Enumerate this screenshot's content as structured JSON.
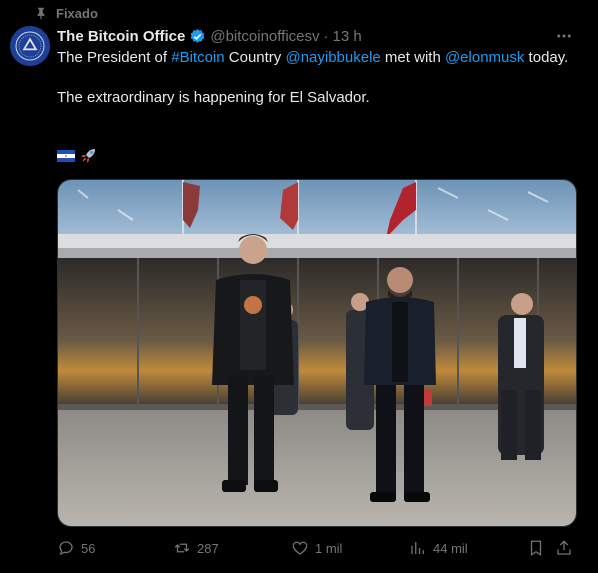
{
  "pinned_label": "Fixado",
  "author": {
    "name": "The Bitcoin Office",
    "handle": "@bitcoinofficesv",
    "separator": "·",
    "time": "13 h"
  },
  "tweet": {
    "part1": "The President of ",
    "hashtag": "#Bitcoin",
    "part2": " Country ",
    "mention1": "@nayibbukele",
    "part3": " met with ",
    "mention2": "@elonmusk",
    "part4": " today.",
    "line2": "The extraordinary is happening for El Salvador."
  },
  "emojis": [
    "el-salvador-flag",
    "rocket"
  ],
  "stats": {
    "replies": "56",
    "reposts": "287",
    "likes": "1 mil",
    "views": "44 mil"
  },
  "icons": {
    "pin": "pin-icon",
    "verified": "verified-badge-icon",
    "more": "more-icon",
    "reply": "reply-icon",
    "repost": "repost-icon",
    "like": "heart-icon",
    "views": "views-icon",
    "bookmark": "bookmark-icon",
    "share": "share-icon"
  },
  "colors": {
    "link": "#1d9bf0",
    "muted": "#71767b",
    "text": "#e7e9ea",
    "background": "#000000"
  }
}
